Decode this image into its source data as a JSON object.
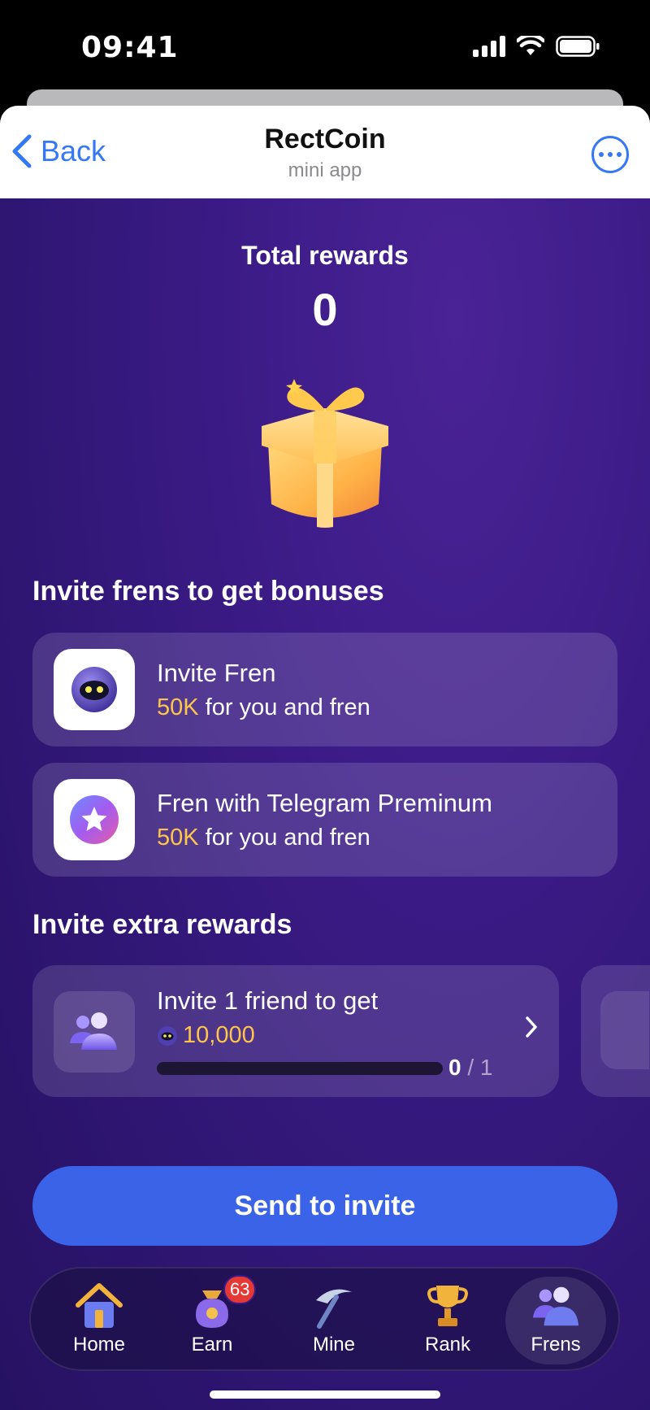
{
  "status_bar": {
    "time": "09:41"
  },
  "header": {
    "back_label": "Back",
    "title": "RectCoin",
    "subtitle": "mini app"
  },
  "rewards": {
    "label": "Total rewards",
    "value": "0"
  },
  "invite_section": {
    "title": "Invite frens to get bonuses",
    "cards": [
      {
        "title": "Invite Fren",
        "amount": "50K",
        "suffix": " for you and fren",
        "icon": "robot-avatar-icon"
      },
      {
        "title": "Fren with Telegram Preminum",
        "amount": "50K",
        "suffix": " for you and fren",
        "icon": "telegram-premium-star-icon"
      }
    ]
  },
  "extra_section": {
    "title": "Invite extra rewards",
    "card": {
      "title": "Invite 1 friend to get",
      "reward": "10,000",
      "progress_current": "0",
      "progress_total": " / 1",
      "progress_fraction": 0
    }
  },
  "send_button": {
    "label": "Send to invite"
  },
  "tabbar": {
    "tabs": [
      {
        "label": "Home",
        "icon": "house-icon"
      },
      {
        "label": "Earn",
        "icon": "money-bag-icon",
        "badge": "63"
      },
      {
        "label": "Mine",
        "icon": "pickaxe-icon"
      },
      {
        "label": "Rank",
        "icon": "trophy-icon"
      },
      {
        "label": "Frens",
        "icon": "friends-icon",
        "active": true
      }
    ]
  },
  "colors": {
    "accent_blue": "#3478f6",
    "button_blue": "#3a63e8",
    "background_purple": "#3b1b86",
    "gold": "#ffc54a"
  }
}
